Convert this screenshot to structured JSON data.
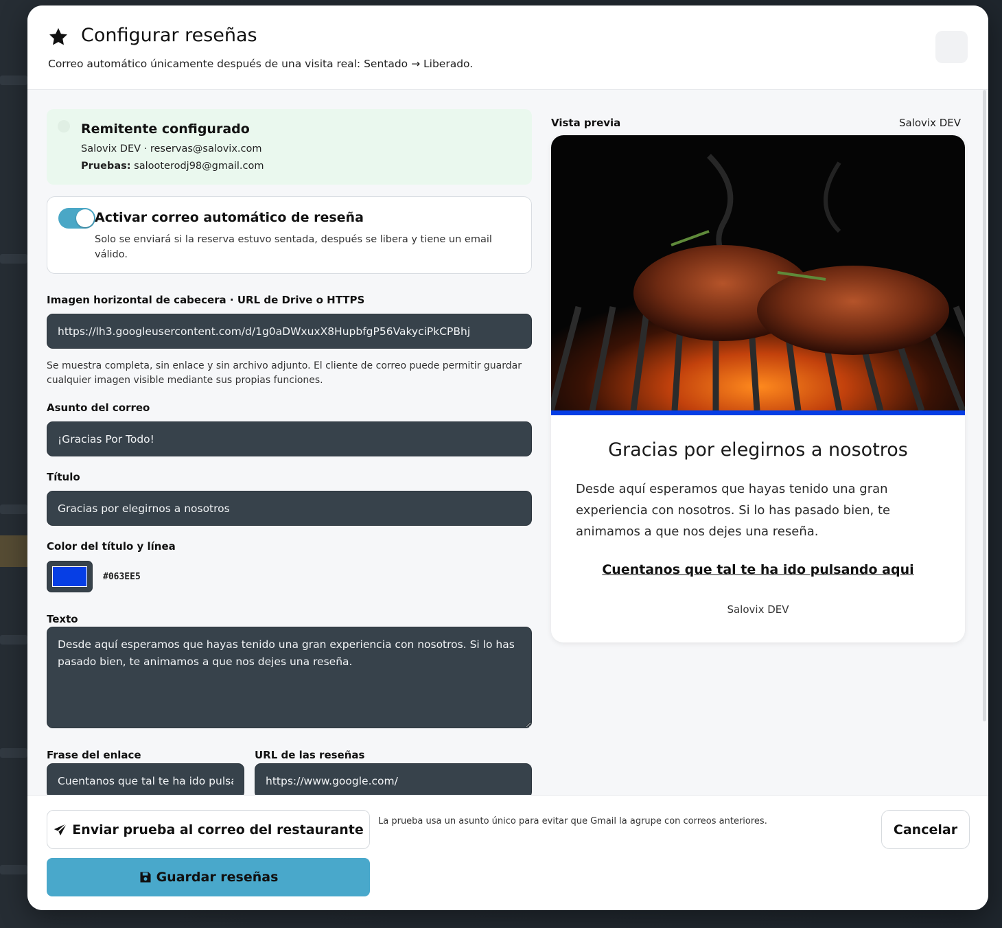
{
  "header": {
    "title": "Configurar reseñas",
    "subtitle": "Correo automático únicamente después de una visita real: Sentado → Liberado."
  },
  "sender": {
    "title": "Remitente configurado",
    "line": "Salovix DEV · reservas@salovix.com",
    "tests_label": "Pruebas:",
    "tests_email": " salooterodj98@gmail.com"
  },
  "toggle": {
    "enabled": true,
    "title": "Activar correo automático de reseña",
    "description": "Solo se enviará si la reserva estuvo sentada, después se libera y tiene un email válido."
  },
  "form": {
    "image_label": "Imagen horizontal de cabecera · URL de Drive o HTTPS",
    "image_url": "https://lh3.googleusercontent.com/d/1g0aDWxuxX8HupbfgP56VakyciPkCPBhj",
    "image_help": "Se muestra completa, sin enlace y sin archivo adjunto. El cliente de correo puede permitir guardar cualquier imagen visible mediante sus propias funciones.",
    "subject_label": "Asunto del correo",
    "subject_value": "¡Gracias Por Todo!",
    "title_label": "Título",
    "title_value": "Gracias por elegirnos a nosotros",
    "color_label": "Color del título y línea",
    "color_value": "#063EE5",
    "text_label": "Texto",
    "text_value": "Desde aquí esperamos que hayas tenido una gran experiencia con nosotros. Si lo has pasado bien, te animamos a que nos dejes una reseña.",
    "link_phrase_label": "Frase del enlace",
    "link_phrase_value": "Cuentanos que tal te ha ido pulsando aqui",
    "reviews_url_label": "URL de las reseñas",
    "reviews_url_value": "https://www.google.com/"
  },
  "preview": {
    "label": "Vista previa",
    "brand": "Salovix DEV",
    "title": "Gracias por elegirnos a nosotros",
    "text": "Desde aquí esperamos que hayas tenido una gran experiencia con nosotros. Si lo has pasado bien, te animamos a que nos dejes una reseña.",
    "link": "Cuentanos que tal te ha ido pulsando aqui",
    "footer": "Salovix DEV",
    "accent_color": "#063EE5"
  },
  "footer": {
    "test_button": "Enviar prueba al correo del restaurante",
    "note": "La prueba usa un asunto único para evitar que Gmail la agrupe con correos anteriores.",
    "cancel_button": "Cancelar",
    "save_button": "Guardar reseñas"
  },
  "icons": {
    "title": "star-icon",
    "test": "paper-plane-icon",
    "save": "floppy-disk-icon"
  }
}
